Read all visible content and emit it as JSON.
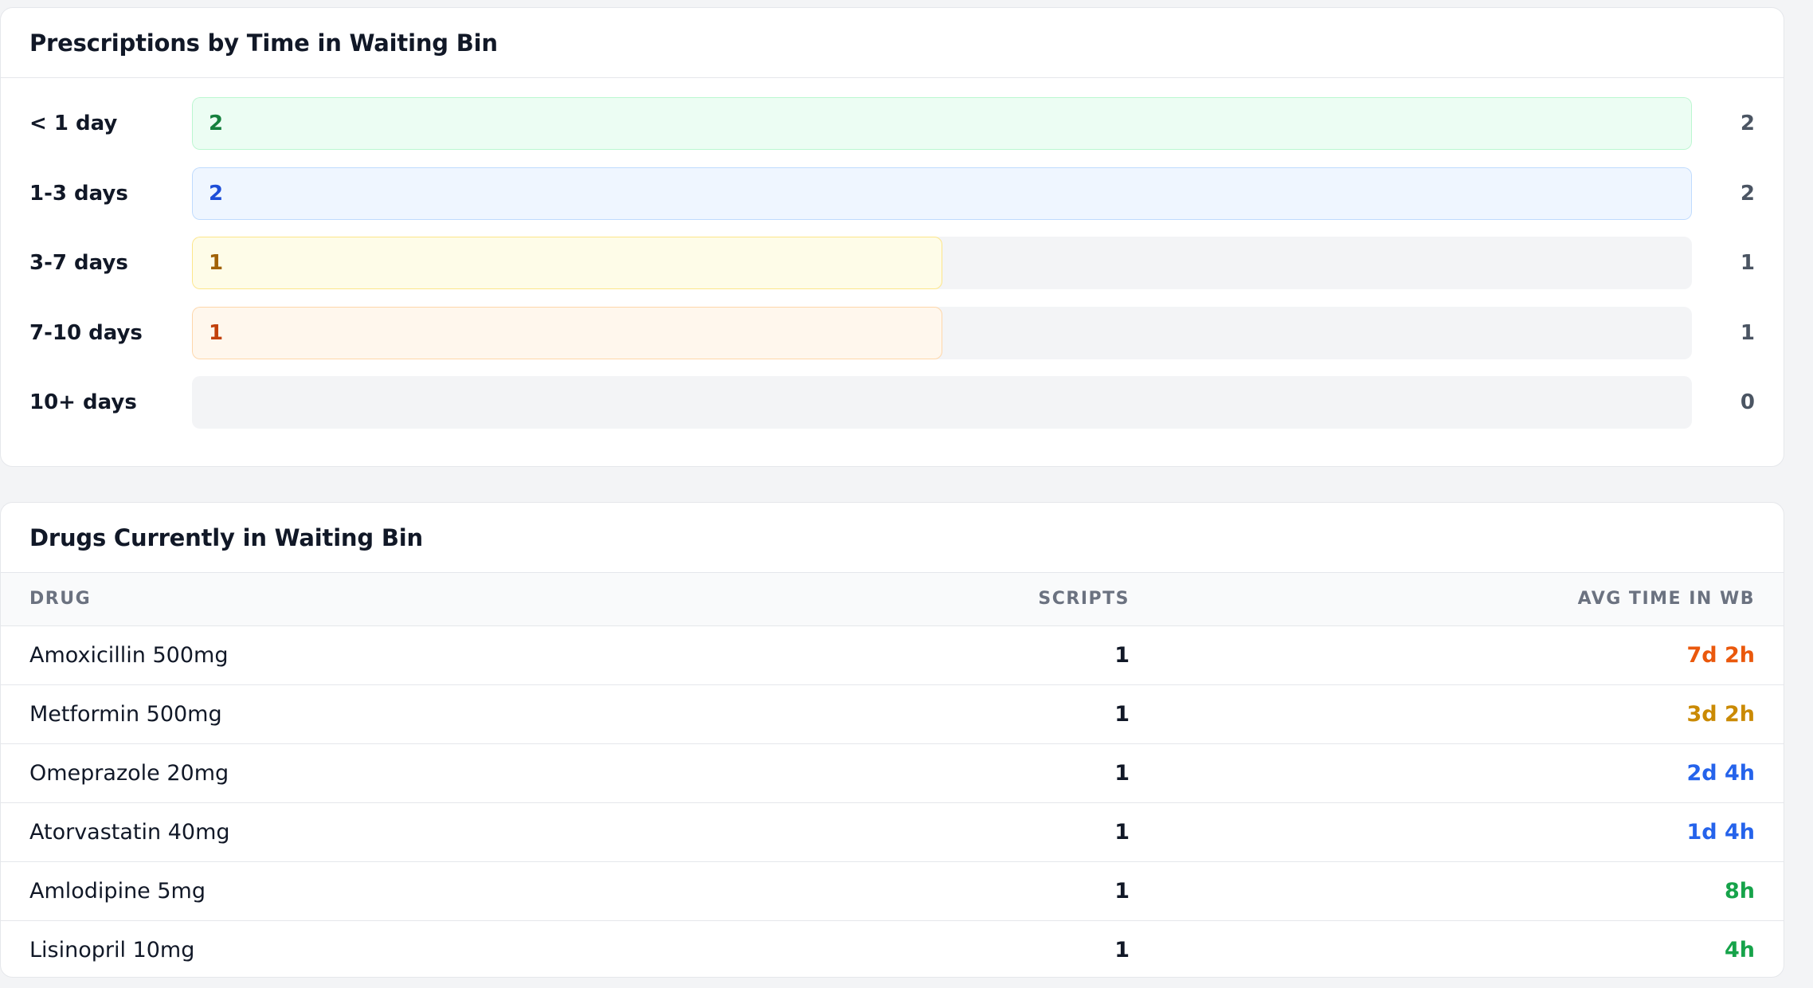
{
  "bins_card": {
    "title": "Prescriptions by Time in Waiting Bin",
    "max_count": 2,
    "rows": [
      {
        "label": "< 1 day",
        "count": 2,
        "bar_text": "2",
        "count_text": "2",
        "bar_bg": "#ecfdf3",
        "bar_border": "#bbf7d0",
        "bar_color": "#15803d"
      },
      {
        "label": "1-3 days",
        "count": 2,
        "bar_text": "2",
        "count_text": "2",
        "bar_bg": "#eff6ff",
        "bar_border": "#bfdbfe",
        "bar_color": "#1d4ed8"
      },
      {
        "label": "3-7 days",
        "count": 1,
        "bar_text": "1",
        "count_text": "1",
        "bar_bg": "#fefce8",
        "bar_border": "#fde68a",
        "bar_color": "#a16207"
      },
      {
        "label": "7-10 days",
        "count": 1,
        "bar_text": "1",
        "count_text": "1",
        "bar_bg": "#fff7ed",
        "bar_border": "#fed7aa",
        "bar_color": "#c2410c"
      },
      {
        "label": "10+ days",
        "count": 0,
        "bar_text": "",
        "count_text": "0",
        "bar_bg": "#fef2f2",
        "bar_border": "#fecaca",
        "bar_color": "#b91c1c"
      }
    ]
  },
  "drugs_card": {
    "title": "Drugs Currently in Waiting Bin",
    "headers": {
      "drug": "DRUG",
      "scripts": "SCRIPTS",
      "avg": "AVG TIME IN WB"
    },
    "rows": [
      {
        "drug": "Amoxicillin 500mg",
        "scripts": "1",
        "avg": "7d 2h",
        "avg_color": "#ea580c"
      },
      {
        "drug": "Metformin 500mg",
        "scripts": "1",
        "avg": "3d 2h",
        "avg_color": "#ca8a04"
      },
      {
        "drug": "Omeprazole 20mg",
        "scripts": "1",
        "avg": "2d 4h",
        "avg_color": "#2563eb"
      },
      {
        "drug": "Atorvastatin 40mg",
        "scripts": "1",
        "avg": "1d 4h",
        "avg_color": "#2563eb"
      },
      {
        "drug": "Amlodipine 5mg",
        "scripts": "1",
        "avg": "8h",
        "avg_color": "#16a34a"
      },
      {
        "drug": "Lisinopril 10mg",
        "scripts": "1",
        "avg": "4h",
        "avg_color": "#16a34a"
      }
    ]
  }
}
